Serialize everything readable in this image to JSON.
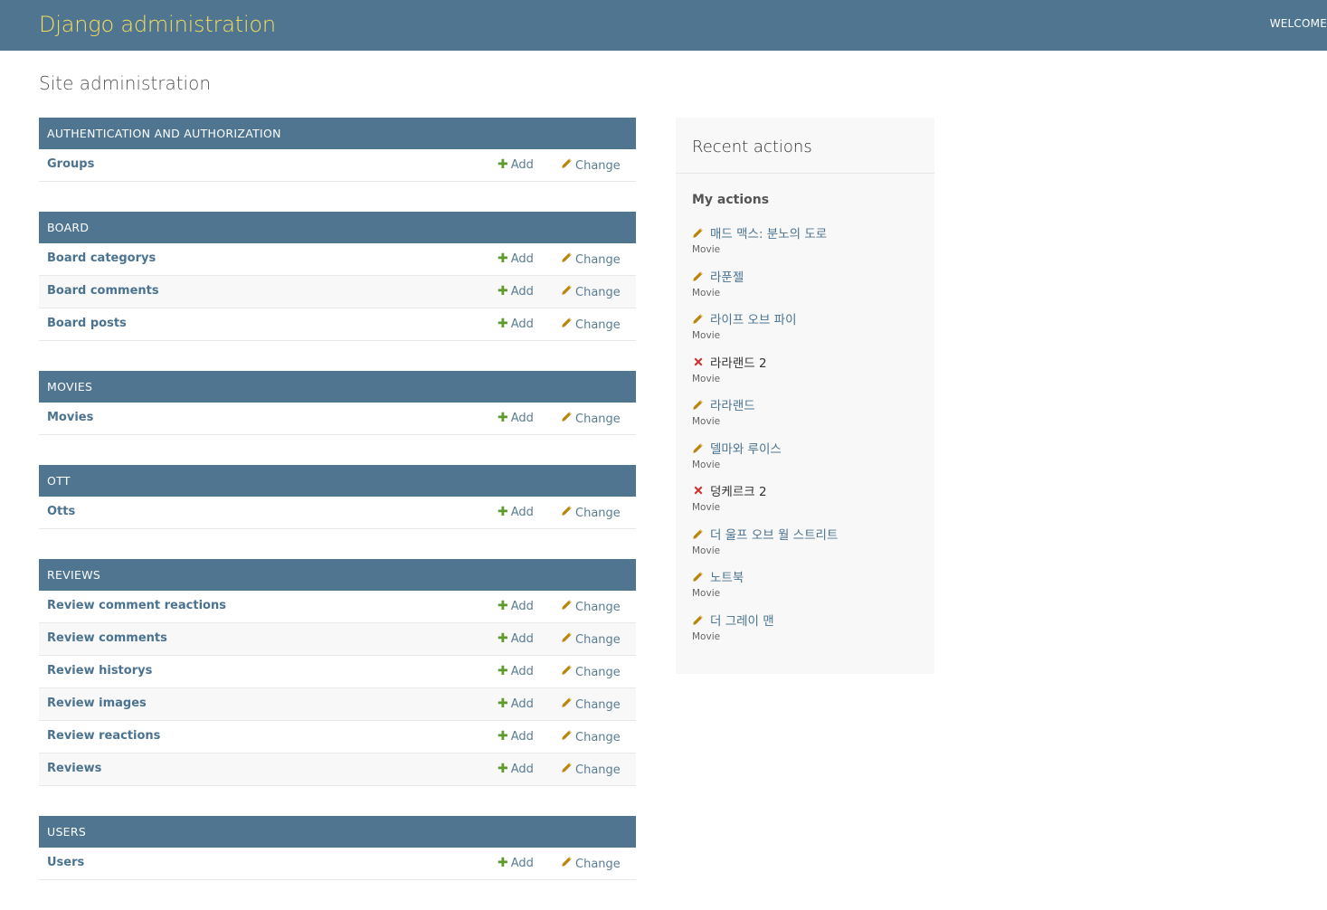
{
  "header": {
    "branding": "Django administration",
    "user_tools": "WELCOME"
  },
  "page_title": "Site administration",
  "modules": [
    {
      "caption": "AUTHENTICATION AND AUTHORIZATION",
      "models": [
        {
          "name": "Groups"
        }
      ]
    },
    {
      "caption": "BOARD",
      "models": [
        {
          "name": "Board categorys"
        },
        {
          "name": "Board comments"
        },
        {
          "name": "Board posts"
        }
      ]
    },
    {
      "caption": "MOVIES",
      "models": [
        {
          "name": "Movies"
        }
      ]
    },
    {
      "caption": "OTT",
      "models": [
        {
          "name": "Otts"
        }
      ]
    },
    {
      "caption": "REVIEWS",
      "models": [
        {
          "name": "Review comment reactions"
        },
        {
          "name": "Review comments"
        },
        {
          "name": "Review historys"
        },
        {
          "name": "Review images"
        },
        {
          "name": "Review reactions"
        },
        {
          "name": "Reviews"
        }
      ]
    },
    {
      "caption": "USERS",
      "models": [
        {
          "name": "Users"
        }
      ]
    }
  ],
  "links": {
    "add_label": "Add",
    "change_label": "Change"
  },
  "recent": {
    "title": "Recent actions",
    "my_actions_title": "My actions",
    "actions": [
      {
        "icon": "pencil-icon",
        "name": "매드 맥스: 분노의 도로",
        "type": "Movie"
      },
      {
        "icon": "pencil-icon",
        "name": "라푼젤",
        "type": "Movie"
      },
      {
        "icon": "pencil-icon",
        "name": "라이프 오브 파이",
        "type": "Movie"
      },
      {
        "icon": "delete-icon",
        "name": "라라랜드 2",
        "type": "Movie"
      },
      {
        "icon": "pencil-icon",
        "name": "라라랜드",
        "type": "Movie"
      },
      {
        "icon": "pencil-icon",
        "name": "델마와 루이스",
        "type": "Movie"
      },
      {
        "icon": "delete-icon",
        "name": "덩케르크 2",
        "type": "Movie"
      },
      {
        "icon": "pencil-icon",
        "name": "더 울프 오브 월 스트리트",
        "type": "Movie"
      },
      {
        "icon": "pencil-icon",
        "name": "노트북",
        "type": "Movie"
      },
      {
        "icon": "pencil-icon",
        "name": "더 그레이 맨",
        "type": "Movie"
      }
    ]
  },
  "colors": {
    "header_bg": "#4f7591",
    "branding": "#f5dd5d",
    "link": "#4b7390",
    "add_icon": "#5c9a2a",
    "pencil_icon": "#b8860b",
    "delete_icon": "#cc3434"
  }
}
